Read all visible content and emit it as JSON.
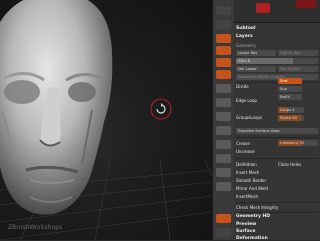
{
  "viewport": {
    "watermark": "ZBrushWorkshops",
    "rotate_cursor": "rotate-icon"
  },
  "palette": {
    "subtool": "Subtool",
    "layers": "Layers",
    "geometry": "Geometry",
    "lower_res": "Lower Res",
    "higher_res": "Higher Res",
    "sdiv": "SDiv 6",
    "del_lower": "Del Lower",
    "del_higher": "Del Higher",
    "reproject": "Reproject Higher Subdiv",
    "divide": "Divide",
    "smt": "Smt",
    "suv": "Suv",
    "reuv": "ReUV",
    "edge_loop": "Edge Loop",
    "groups_loops": "GroupsLoops",
    "loops": "Loops 4",
    "polish": "Polish 90",
    "equalize": "Equalize Surface Area",
    "crease": "Crease",
    "uncrease": "Uncrease",
    "crease_lvl": "CreaseLvl 15",
    "dellhidden": "DelHidden",
    "close_holes": "Close Holes",
    "insert_mesh": "Insert Mesh",
    "smooth_border": "Smooth Border",
    "mirror_weld": "Mirror And Weld",
    "insert_mesh2": "InsertMesh",
    "check_mesh": "Check Mesh Integrity",
    "geometry_hd": "Geometry HD",
    "preview": "Preview",
    "surface": "Surface",
    "deformation": "Deformation"
  },
  "colors": {
    "accent": "#c8531a",
    "record": "#b02020"
  }
}
